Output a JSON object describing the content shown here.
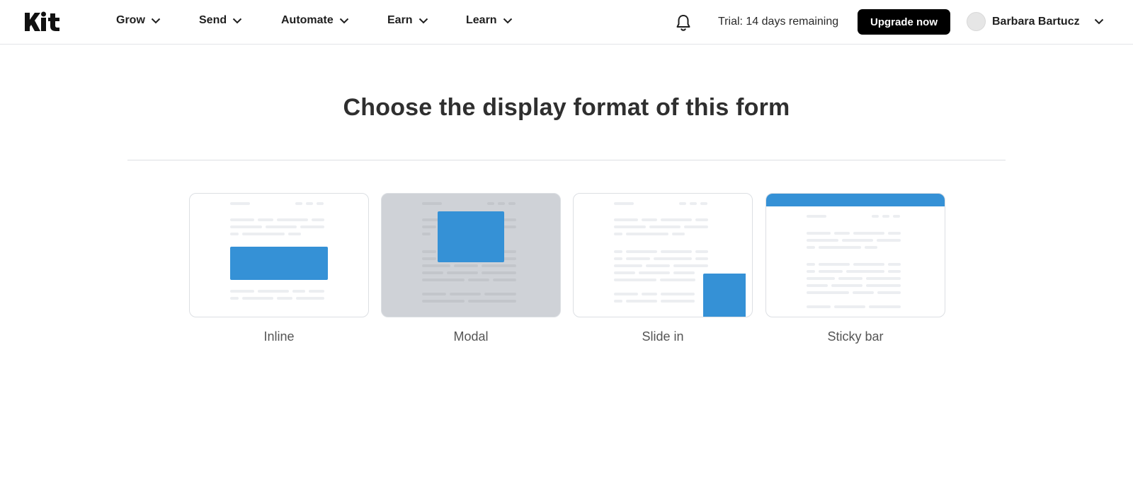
{
  "header": {
    "logo": "Kit",
    "nav": [
      {
        "label": "Grow"
      },
      {
        "label": "Send"
      },
      {
        "label": "Automate"
      },
      {
        "label": "Earn"
      },
      {
        "label": "Learn"
      }
    ],
    "trial_text": "Trial: 14 days remaining",
    "upgrade_label": "Upgrade now",
    "user_name": "Barbara Bartucz"
  },
  "main": {
    "title": "Choose the display format of this form",
    "options": [
      {
        "label": "Inline"
      },
      {
        "label": "Modal"
      },
      {
        "label": "Slide in"
      },
      {
        "label": "Sticky bar"
      }
    ]
  },
  "colors": {
    "accent_blue": "#3591d6",
    "modal_overlay": "#cfd2d7",
    "button_black": "#000000"
  }
}
